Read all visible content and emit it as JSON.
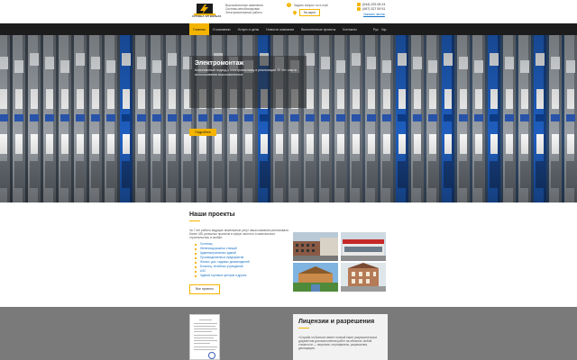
{
  "header": {
    "logo_caption": "СЛУЖБА ЭЛ ВОЛЬТА",
    "tagline": [
      "Высоковольтные изменения",
      "Системы автоблокировки",
      "Электромонтажные работы"
    ],
    "question_link": "Задать вопрос по e-mail",
    "map_button": "На карте",
    "phones": [
      "(044) 225 08 24",
      "(067) 327 59 51"
    ],
    "callback_link": "Заказать звонок"
  },
  "nav": {
    "items": [
      "Главная",
      "О компании",
      "Услуги и цены",
      "Новости компании",
      "Выполненные проекты",
      "Контакты"
    ],
    "active_index": 0,
    "languages": [
      "Рус",
      "Укр"
    ]
  },
  "hero": {
    "title": "Электромонтаж",
    "text": "Комплексный подход к электромонтажу и реализации 20 лет опыта использования высоковольтных",
    "bullets": [
      "•",
      "•",
      "•"
    ],
    "button_label": "Подробнее"
  },
  "projects": {
    "title": "Наши проекты",
    "intro": "За 7 лет работы ведущие инженерные услуг наша компания реализовала более 430 успешных проектов в сфере частного и капитального строительства, в ячейке:",
    "list": [
      "Гостиниц",
      "Железнодорожных станций",
      "Административных зданий",
      "Производственных предприятий",
      "Жилых, дач, садовых домовладений",
      "Больниц, лечебных учреждений",
      "АЗС",
      "Зданий торговых центров и других"
    ],
    "button_label": "Все проекты"
  },
  "licenses": {
    "title": "Лицензии и разрешения",
    "text": "«Служба эл.Вольта» имеет полный пакет разрешительных документов для выполнения работ на объектах любой сложности — лицензии, сертификаты, разрешения, декларации."
  },
  "colors": {
    "accent": "#f5b400",
    "nav_bg": "#1c1c1c",
    "link": "#1a73c6",
    "license_bg": "#7a7a7a"
  }
}
